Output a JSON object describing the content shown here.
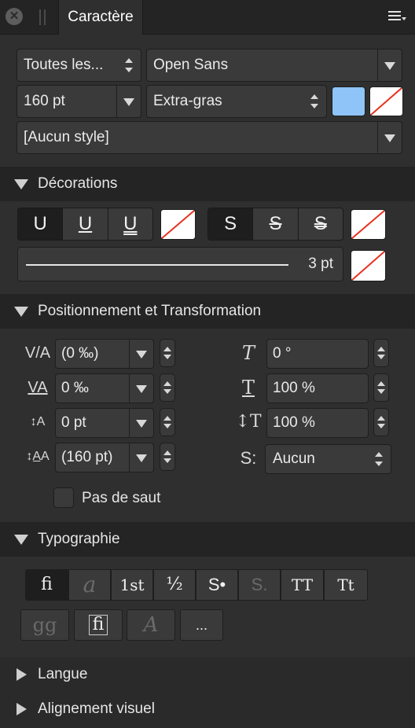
{
  "tabbar": {
    "tab_title": "Caractère",
    "close_icon": "close-icon",
    "menu_icon": "hamburger-menu-icon"
  },
  "font": {
    "collection": "Toutes les...",
    "family": "Open Sans",
    "size": "160 pt",
    "weight": "Extra-gras",
    "fill_color": "#8ec4f8",
    "style": "[Aucun style]"
  },
  "decorations": {
    "title": "Décorations",
    "underline_buttons": [
      "U",
      "U",
      "U"
    ],
    "strike_buttons": [
      "S",
      "S",
      "S"
    ],
    "line_weight": "3 pt"
  },
  "positioning": {
    "title": "Positionnement et Transformation",
    "left_fields": [
      {
        "icon": "kerning-icon",
        "value": "(0 ‰)"
      },
      {
        "icon": "tracking-icon",
        "value": "0 ‰"
      },
      {
        "icon": "baseline-shift-icon",
        "value": "0 pt"
      },
      {
        "icon": "leading-icon",
        "value": "(160 pt)"
      }
    ],
    "right_fields": [
      {
        "icon": "shear-icon",
        "value": "0 °"
      },
      {
        "icon": "horizontal-scale-icon",
        "value": "100 %"
      },
      {
        "icon": "vertical-scale-icon",
        "value": "100 %"
      }
    ],
    "script_value": "Aucun",
    "no_break_label": "Pas de saut"
  },
  "typography": {
    "title": "Typographie",
    "row1": [
      "fi",
      "a",
      "1st",
      "½",
      "S•",
      "S.",
      "TT",
      "Tt"
    ],
    "row2": [
      "gg",
      "fi",
      "A",
      "..."
    ]
  },
  "collapsed_sections": [
    "Langue",
    "Alignement visuel"
  ]
}
